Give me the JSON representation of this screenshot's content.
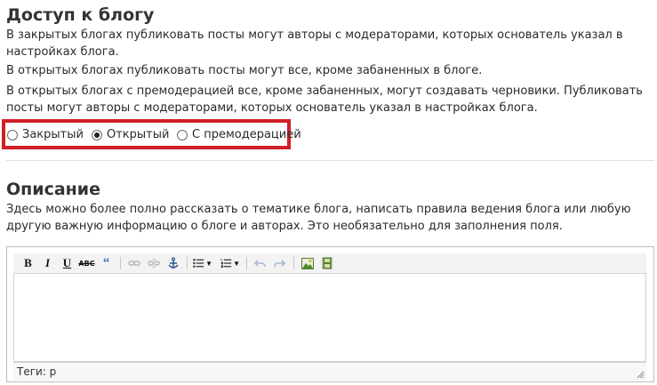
{
  "access": {
    "title": "Доступ к блогу",
    "p1": "В закрытых блогах публиковать посты могут авторы с модераторами, которых основатель указал в настройках блога.",
    "p2": "В открытых блогах публиковать посты могут все, кроме забаненных в блоге.",
    "p3": "В открытых блогах с премодерацией все, кроме забаненных, могут создавать черновики. Публиковать посты могут авторы с модераторами, которых основатель указал в настройках блога.",
    "options": [
      {
        "label": "Закрытый",
        "selected": false
      },
      {
        "label": "Открытый",
        "selected": true
      },
      {
        "label": "С премодерацией",
        "selected": false
      }
    ]
  },
  "description": {
    "title": "Описание",
    "text": "Здесь можно более полно рассказать о тематике блога, написать правила ведения блога или любую другую важную информацию о блоге и авторах. Это необязательно для заполнения поля."
  },
  "editor": {
    "status": "Теги: p",
    "highlight_color": "#d11f26"
  }
}
